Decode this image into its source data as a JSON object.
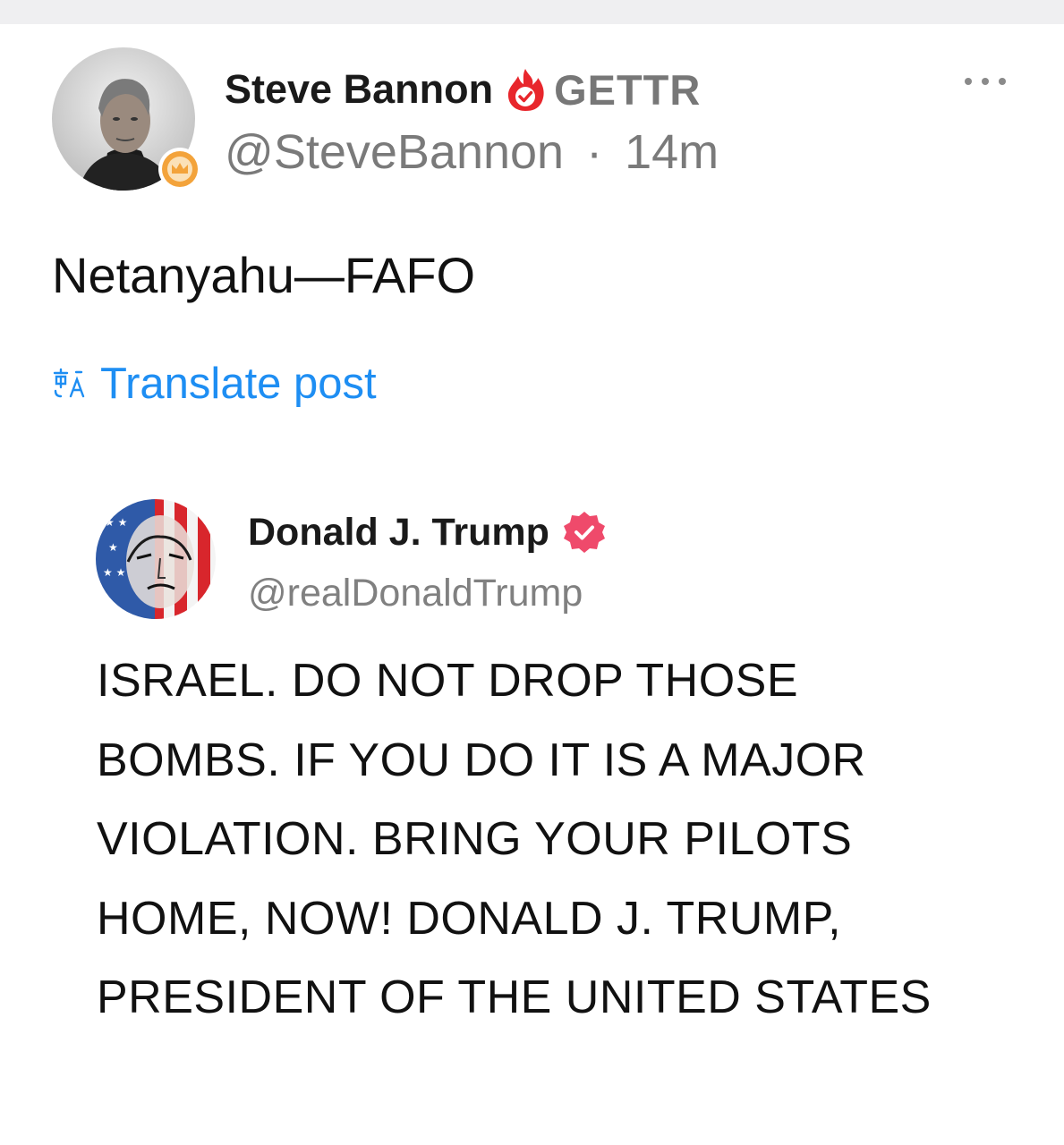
{
  "post": {
    "author": {
      "name": "Steve Bannon",
      "app_tag": "GETTR",
      "handle": "@SteveBannon",
      "separator": "·",
      "time": "14m",
      "avatar_icon": "profile-photo",
      "badge_icon": "crown-badge-icon",
      "verified_icon": "flame-verified-icon"
    },
    "more_icon": "ellipsis-icon",
    "text": "Netanyahu—FAFO",
    "translate": {
      "icon": "translate-icon",
      "label": "Translate post"
    },
    "quoted": {
      "name": "Donald J. Trump",
      "handle": "@realDonaldTrump",
      "avatar_icon": "flag-portrait-avatar",
      "verified_icon": "verified-badge-icon",
      "text": "ISRAEL. DO NOT DROP THOSE BOMBS. IF YOU DO IT IS A MAJOR VIOLATION. BRING YOUR PILOTS HOME, NOW!  DONALD J. TRUMP, PRESIDENT OF THE UNITED STATES"
    }
  },
  "colors": {
    "link_blue": "#1e8ef3",
    "verified_red": "#e8262c",
    "quoted_verified": "#ef4a6b",
    "badge_orange": "#f3a33b",
    "top_bar": "#efeff1"
  }
}
